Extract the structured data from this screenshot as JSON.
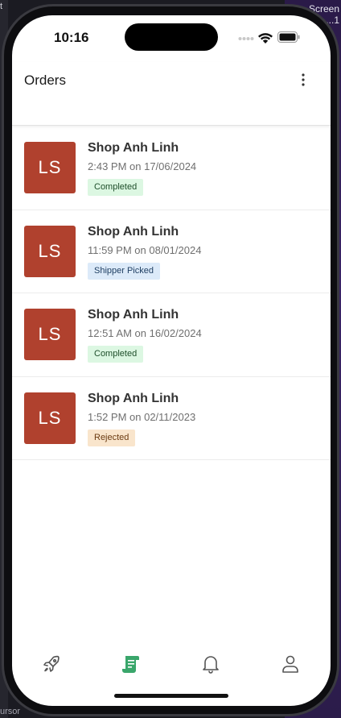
{
  "background": {
    "right_label": "Screen",
    "right_label_2": "...1",
    "left_label": "t",
    "bottom_label": "ursor"
  },
  "status_bar": {
    "time": "10:16"
  },
  "header": {
    "title": "Orders",
    "menu_icon": "more-vertical-icon"
  },
  "orders": [
    {
      "initials": "LS",
      "shop": "Shop Anh Linh",
      "time": "2:43 PM on 17/06/2024",
      "status": "Completed",
      "status_type": "completed"
    },
    {
      "initials": "LS",
      "shop": "Shop Anh Linh",
      "time": "11:59 PM on 08/01/2024",
      "status": "Shipper Picked",
      "status_type": "picked"
    },
    {
      "initials": "LS",
      "shop": "Shop Anh Linh",
      "time": "12:51 AM on 16/02/2024",
      "status": "Completed",
      "status_type": "completed"
    },
    {
      "initials": "LS",
      "shop": "Shop Anh Linh",
      "time": "1:52 PM on 02/11/2023",
      "status": "Rejected",
      "status_type": "rejected"
    }
  ],
  "tabs": [
    {
      "icon": "rocket-icon",
      "active": false
    },
    {
      "icon": "orders-receipt-icon",
      "active": true
    },
    {
      "icon": "bell-icon",
      "active": false
    },
    {
      "icon": "profile-icon",
      "active": false
    }
  ],
  "colors": {
    "avatar_bg": "#b0412e",
    "active_tab": "#3aa66b",
    "inactive_tab": "#555555"
  }
}
